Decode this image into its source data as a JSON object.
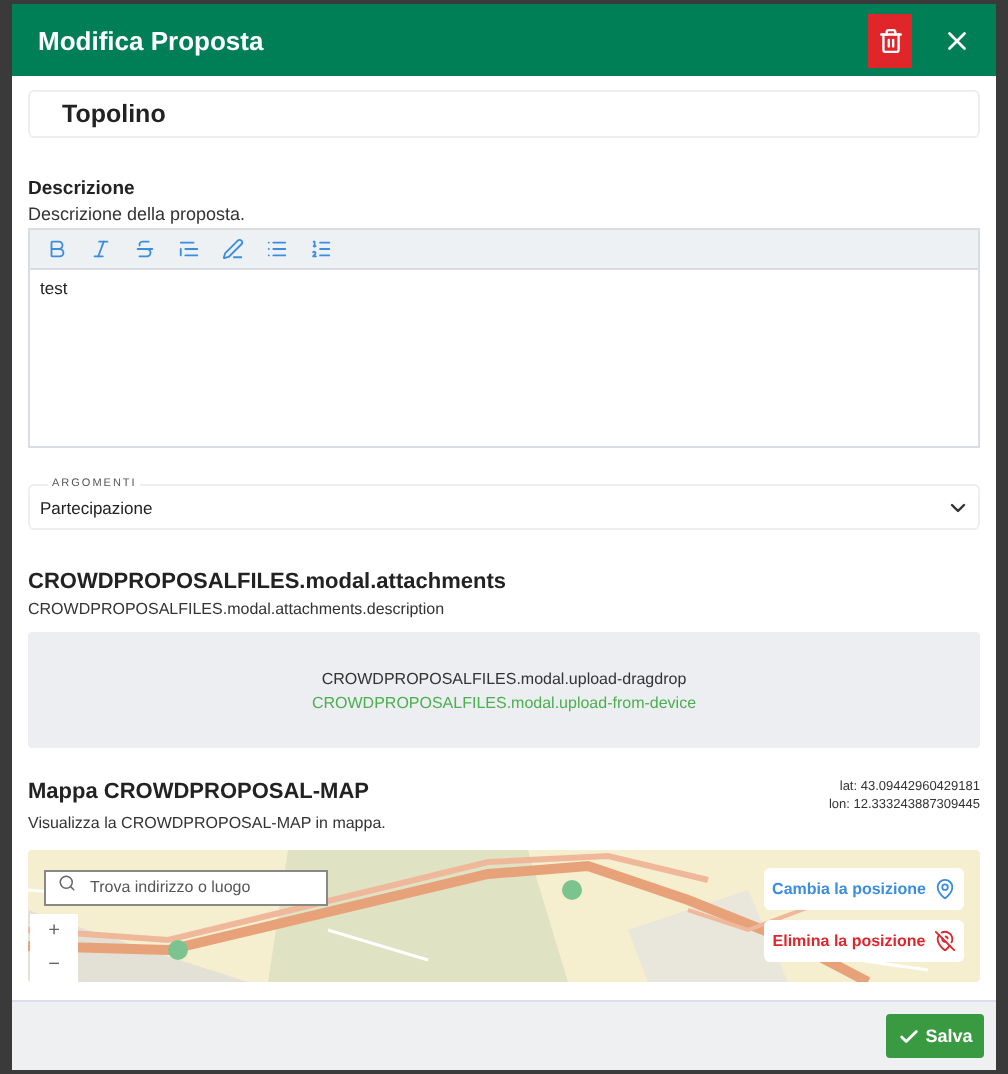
{
  "modal": {
    "title": "Modifica Proposta"
  },
  "title_field": {
    "value": "Topolino"
  },
  "description": {
    "label": "Descrizione",
    "hint": "Descrizione della proposta.",
    "toolbar": [
      {
        "kind": "bold"
      },
      {
        "kind": "italic"
      },
      {
        "kind": "strike"
      },
      {
        "kind": "quote"
      },
      {
        "kind": "pen"
      },
      {
        "kind": "bullet"
      },
      {
        "kind": "ordered"
      }
    ],
    "value": "test"
  },
  "topics": {
    "legend": "ARGOMENTI",
    "value": "Partecipazione"
  },
  "attachments": {
    "title": "CROWDPROPOSALFILES.modal.attachments",
    "description": "CROWDPROPOSALFILES.modal.attachments.description",
    "dragdrop": "CROWDPROPOSALFILES.modal.upload-dragdrop",
    "upload_link": "CROWDPROPOSALFILES.modal.upload-from-device"
  },
  "map": {
    "title": "Mappa CROWDPROPOSAL-MAP",
    "description": "Visualizza la CROWDPROPOSAL-MAP in mappa.",
    "lat": "lat: 43.09442960429181",
    "lon": "lon: 12.333243887309445",
    "search_placeholder": "Trova indirizzo o luogo",
    "zoom_in": "+",
    "zoom_out": "−",
    "change": "Cambia la posizione",
    "remove": "Elimina la posizione"
  },
  "footer": {
    "save": "Salva"
  }
}
